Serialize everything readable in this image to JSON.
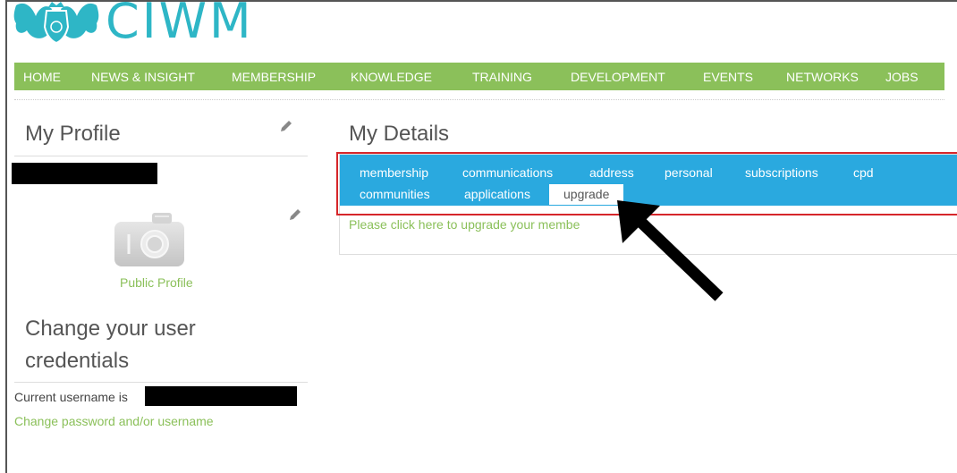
{
  "brand": {
    "name": "CIWM",
    "crest_icon": "crest-icon",
    "color": "#2eb6c6"
  },
  "nav": {
    "color": "#8bc05a",
    "items": [
      "HOME",
      "NEWS & INSIGHT",
      "MEMBERSHIP",
      "KNOWLEDGE",
      "TRAINING",
      "DEVELOPMENT",
      "EVENTS",
      "NETWORKS",
      "JOBS"
    ]
  },
  "left": {
    "profile_title": "My Profile",
    "edit_icon": "pencil-icon",
    "avatar_icon": "camera-icon",
    "public_profile": "Public Profile",
    "credentials_title": "Change your user credentials",
    "current_username_label": "Current username is",
    "change_link": "Change password and/or username"
  },
  "right": {
    "details_title": "My Details",
    "tab_color": "#2aa9df",
    "tabs": [
      "membership",
      "communications",
      "address",
      "personal",
      "subscriptions",
      "cpd",
      "communities",
      "applications",
      "upgrade"
    ],
    "active_tab": "upgrade",
    "upgrade_message": "Please click here to upgrade your membe"
  },
  "annotation": {
    "highlight_color": "#d6262a",
    "arrow_icon": "arrow-icon"
  }
}
